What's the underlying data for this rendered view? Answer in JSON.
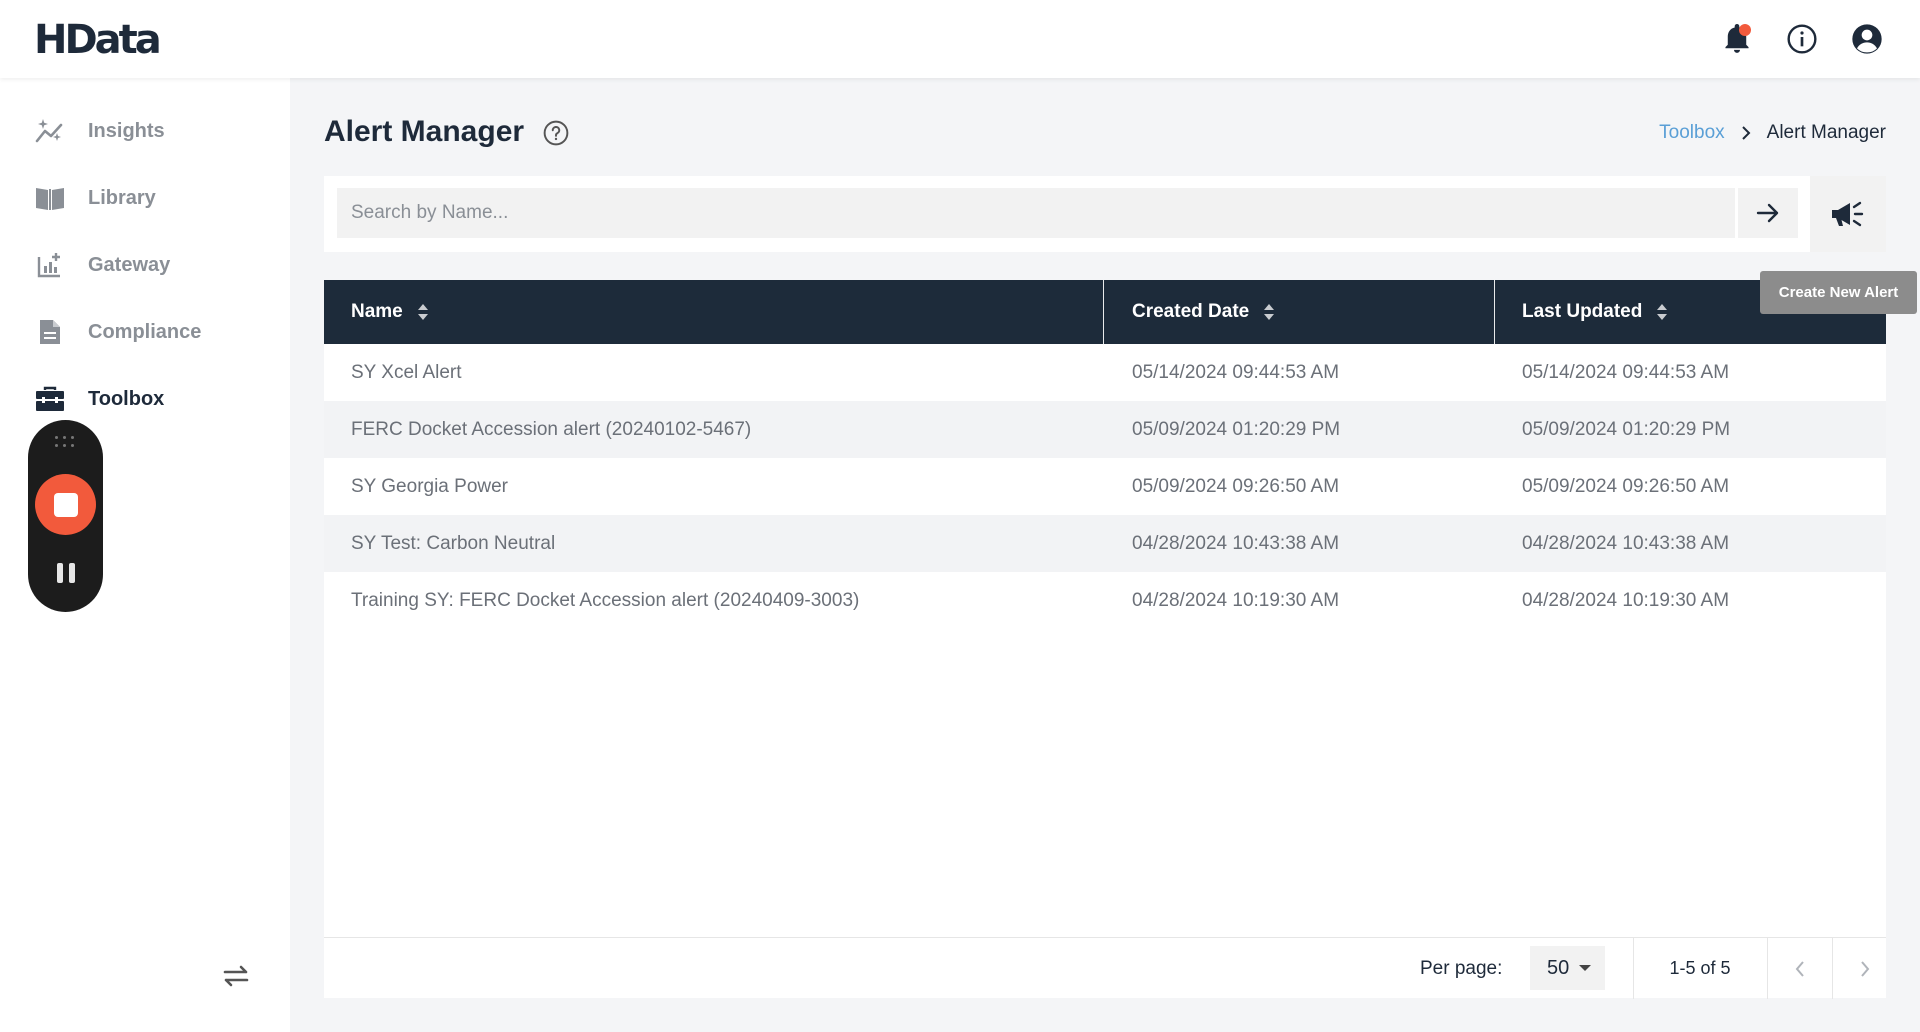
{
  "app": {
    "logo": "HData"
  },
  "header": {
    "icons": [
      "bell-icon",
      "info-icon",
      "account-icon"
    ],
    "notification_color": "#f25a3c"
  },
  "sidebar": {
    "items": [
      {
        "label": "Insights",
        "icon": "sparkle-chart-icon"
      },
      {
        "label": "Library",
        "icon": "book-icon"
      },
      {
        "label": "Gateway",
        "icon": "chart-plus-icon"
      },
      {
        "label": "Compliance",
        "icon": "document-icon"
      },
      {
        "label": "Toolbox",
        "icon": "toolbox-icon",
        "active": true
      }
    ],
    "collapse_icon": "swap-arrows-icon"
  },
  "page": {
    "title": "Alert Manager",
    "breadcrumb": {
      "parent": "Toolbox",
      "current": "Alert Manager"
    }
  },
  "search": {
    "placeholder": "Search by Name...",
    "value": "",
    "create_tooltip": "Create New Alert"
  },
  "table": {
    "columns": [
      "Name",
      "Created Date",
      "Last Updated"
    ],
    "rows": [
      {
        "name": "SY Xcel Alert",
        "created": "05/14/2024 09:44:53 AM",
        "updated": "05/14/2024 09:44:53 AM"
      },
      {
        "name": "FERC Docket Accession alert (20240102-5467)",
        "created": "05/09/2024 01:20:29 PM",
        "updated": "05/09/2024 01:20:29 PM"
      },
      {
        "name": "SY Georgia Power",
        "created": "05/09/2024 09:26:50 AM",
        "updated": "05/09/2024 09:26:50 AM"
      },
      {
        "name": "SY Test: Carbon Neutral",
        "created": "04/28/2024 10:43:38 AM",
        "updated": "04/28/2024 10:43:38 AM"
      },
      {
        "name": "Training SY: FERC Docket Accession alert (20240409-3003)",
        "created": "04/28/2024 10:19:30 AM",
        "updated": "04/28/2024 10:19:30 AM"
      }
    ]
  },
  "pagination": {
    "per_page_label": "Per page:",
    "per_page_value": "50",
    "range_label": "1-5 of 5"
  },
  "colors": {
    "header_bg": "#1d2b3a",
    "link": "#5a9fd6",
    "record": "#f25a3c"
  }
}
